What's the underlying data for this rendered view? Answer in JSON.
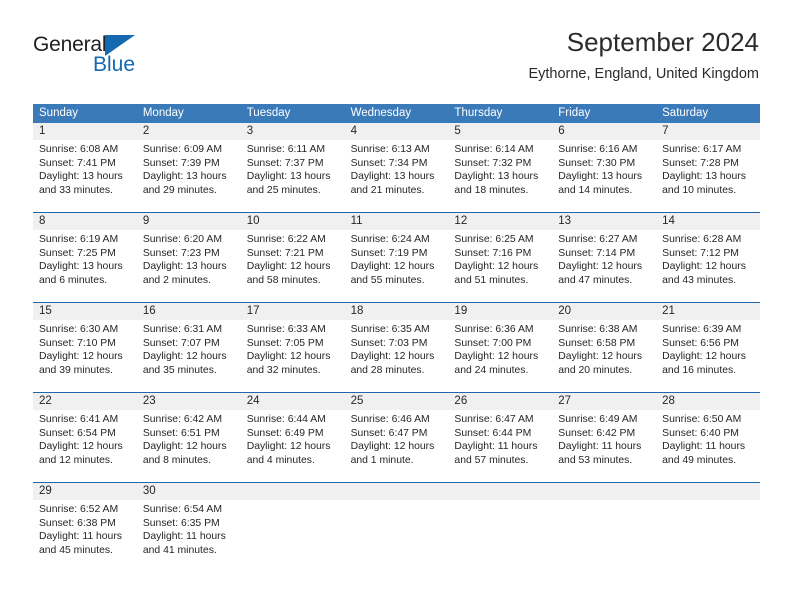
{
  "logo": {
    "name_part1": "General",
    "name_part2": "Blue",
    "triangle_color": "#1569b0"
  },
  "header": {
    "title": "September 2024",
    "subtitle": "Eythorne, England, United Kingdom"
  },
  "colors": {
    "header_bar": "#3b7ab8",
    "week_divider": "#1f68ad",
    "daynum_band": "#f0f0f0",
    "text": "#262626"
  },
  "weekdays": [
    "Sunday",
    "Monday",
    "Tuesday",
    "Wednesday",
    "Thursday",
    "Friday",
    "Saturday"
  ],
  "labels": {
    "sunrise_prefix": "Sunrise:",
    "sunset_prefix": "Sunset:",
    "daylight_prefix": "Daylight:"
  },
  "weeks": [
    {
      "cells": [
        {
          "day": "1",
          "l1": "Sunrise: 6:08 AM",
          "l2": "Sunset: 7:41 PM",
          "l3": "Daylight: 13 hours",
          "l4": "and 33 minutes."
        },
        {
          "day": "2",
          "l1": "Sunrise: 6:09 AM",
          "l2": "Sunset: 7:39 PM",
          "l3": "Daylight: 13 hours",
          "l4": "and 29 minutes."
        },
        {
          "day": "3",
          "l1": "Sunrise: 6:11 AM",
          "l2": "Sunset: 7:37 PM",
          "l3": "Daylight: 13 hours",
          "l4": "and 25 minutes."
        },
        {
          "day": "4",
          "l1": "Sunrise: 6:13 AM",
          "l2": "Sunset: 7:34 PM",
          "l3": "Daylight: 13 hours",
          "l4": "and 21 minutes."
        },
        {
          "day": "5",
          "l1": "Sunrise: 6:14 AM",
          "l2": "Sunset: 7:32 PM",
          "l3": "Daylight: 13 hours",
          "l4": "and 18 minutes."
        },
        {
          "day": "6",
          "l1": "Sunrise: 6:16 AM",
          "l2": "Sunset: 7:30 PM",
          "l3": "Daylight: 13 hours",
          "l4": "and 14 minutes."
        },
        {
          "day": "7",
          "l1": "Sunrise: 6:17 AM",
          "l2": "Sunset: 7:28 PM",
          "l3": "Daylight: 13 hours",
          "l4": "and 10 minutes."
        }
      ]
    },
    {
      "cells": [
        {
          "day": "8",
          "l1": "Sunrise: 6:19 AM",
          "l2": "Sunset: 7:25 PM",
          "l3": "Daylight: 13 hours",
          "l4": "and 6 minutes."
        },
        {
          "day": "9",
          "l1": "Sunrise: 6:20 AM",
          "l2": "Sunset: 7:23 PM",
          "l3": "Daylight: 13 hours",
          "l4": "and 2 minutes."
        },
        {
          "day": "10",
          "l1": "Sunrise: 6:22 AM",
          "l2": "Sunset: 7:21 PM",
          "l3": "Daylight: 12 hours",
          "l4": "and 58 minutes."
        },
        {
          "day": "11",
          "l1": "Sunrise: 6:24 AM",
          "l2": "Sunset: 7:19 PM",
          "l3": "Daylight: 12 hours",
          "l4": "and 55 minutes."
        },
        {
          "day": "12",
          "l1": "Sunrise: 6:25 AM",
          "l2": "Sunset: 7:16 PM",
          "l3": "Daylight: 12 hours",
          "l4": "and 51 minutes."
        },
        {
          "day": "13",
          "l1": "Sunrise: 6:27 AM",
          "l2": "Sunset: 7:14 PM",
          "l3": "Daylight: 12 hours",
          "l4": "and 47 minutes."
        },
        {
          "day": "14",
          "l1": "Sunrise: 6:28 AM",
          "l2": "Sunset: 7:12 PM",
          "l3": "Daylight: 12 hours",
          "l4": "and 43 minutes."
        }
      ]
    },
    {
      "cells": [
        {
          "day": "15",
          "l1": "Sunrise: 6:30 AM",
          "l2": "Sunset: 7:10 PM",
          "l3": "Daylight: 12 hours",
          "l4": "and 39 minutes."
        },
        {
          "day": "16",
          "l1": "Sunrise: 6:31 AM",
          "l2": "Sunset: 7:07 PM",
          "l3": "Daylight: 12 hours",
          "l4": "and 35 minutes."
        },
        {
          "day": "17",
          "l1": "Sunrise: 6:33 AM",
          "l2": "Sunset: 7:05 PM",
          "l3": "Daylight: 12 hours",
          "l4": "and 32 minutes."
        },
        {
          "day": "18",
          "l1": "Sunrise: 6:35 AM",
          "l2": "Sunset: 7:03 PM",
          "l3": "Daylight: 12 hours",
          "l4": "and 28 minutes."
        },
        {
          "day": "19",
          "l1": "Sunrise: 6:36 AM",
          "l2": "Sunset: 7:00 PM",
          "l3": "Daylight: 12 hours",
          "l4": "and 24 minutes."
        },
        {
          "day": "20",
          "l1": "Sunrise: 6:38 AM",
          "l2": "Sunset: 6:58 PM",
          "l3": "Daylight: 12 hours",
          "l4": "and 20 minutes."
        },
        {
          "day": "21",
          "l1": "Sunrise: 6:39 AM",
          "l2": "Sunset: 6:56 PM",
          "l3": "Daylight: 12 hours",
          "l4": "and 16 minutes."
        }
      ]
    },
    {
      "cells": [
        {
          "day": "22",
          "l1": "Sunrise: 6:41 AM",
          "l2": "Sunset: 6:54 PM",
          "l3": "Daylight: 12 hours",
          "l4": "and 12 minutes."
        },
        {
          "day": "23",
          "l1": "Sunrise: 6:42 AM",
          "l2": "Sunset: 6:51 PM",
          "l3": "Daylight: 12 hours",
          "l4": "and 8 minutes."
        },
        {
          "day": "24",
          "l1": "Sunrise: 6:44 AM",
          "l2": "Sunset: 6:49 PM",
          "l3": "Daylight: 12 hours",
          "l4": "and 4 minutes."
        },
        {
          "day": "25",
          "l1": "Sunrise: 6:46 AM",
          "l2": "Sunset: 6:47 PM",
          "l3": "Daylight: 12 hours",
          "l4": "and 1 minute."
        },
        {
          "day": "26",
          "l1": "Sunrise: 6:47 AM",
          "l2": "Sunset: 6:44 PM",
          "l3": "Daylight: 11 hours",
          "l4": "and 57 minutes."
        },
        {
          "day": "27",
          "l1": "Sunrise: 6:49 AM",
          "l2": "Sunset: 6:42 PM",
          "l3": "Daylight: 11 hours",
          "l4": "and 53 minutes."
        },
        {
          "day": "28",
          "l1": "Sunrise: 6:50 AM",
          "l2": "Sunset: 6:40 PM",
          "l3": "Daylight: 11 hours",
          "l4": "and 49 minutes."
        }
      ]
    },
    {
      "cells": [
        {
          "day": "29",
          "l1": "Sunrise: 6:52 AM",
          "l2": "Sunset: 6:38 PM",
          "l3": "Daylight: 11 hours",
          "l4": "and 45 minutes."
        },
        {
          "day": "30",
          "l1": "Sunrise: 6:54 AM",
          "l2": "Sunset: 6:35 PM",
          "l3": "Daylight: 11 hours",
          "l4": "and 41 minutes."
        },
        {
          "day": "",
          "l1": "",
          "l2": "",
          "l3": "",
          "l4": ""
        },
        {
          "day": "",
          "l1": "",
          "l2": "",
          "l3": "",
          "l4": ""
        },
        {
          "day": "",
          "l1": "",
          "l2": "",
          "l3": "",
          "l4": ""
        },
        {
          "day": "",
          "l1": "",
          "l2": "",
          "l3": "",
          "l4": ""
        },
        {
          "day": "",
          "l1": "",
          "l2": "",
          "l3": "",
          "l4": ""
        }
      ]
    }
  ]
}
